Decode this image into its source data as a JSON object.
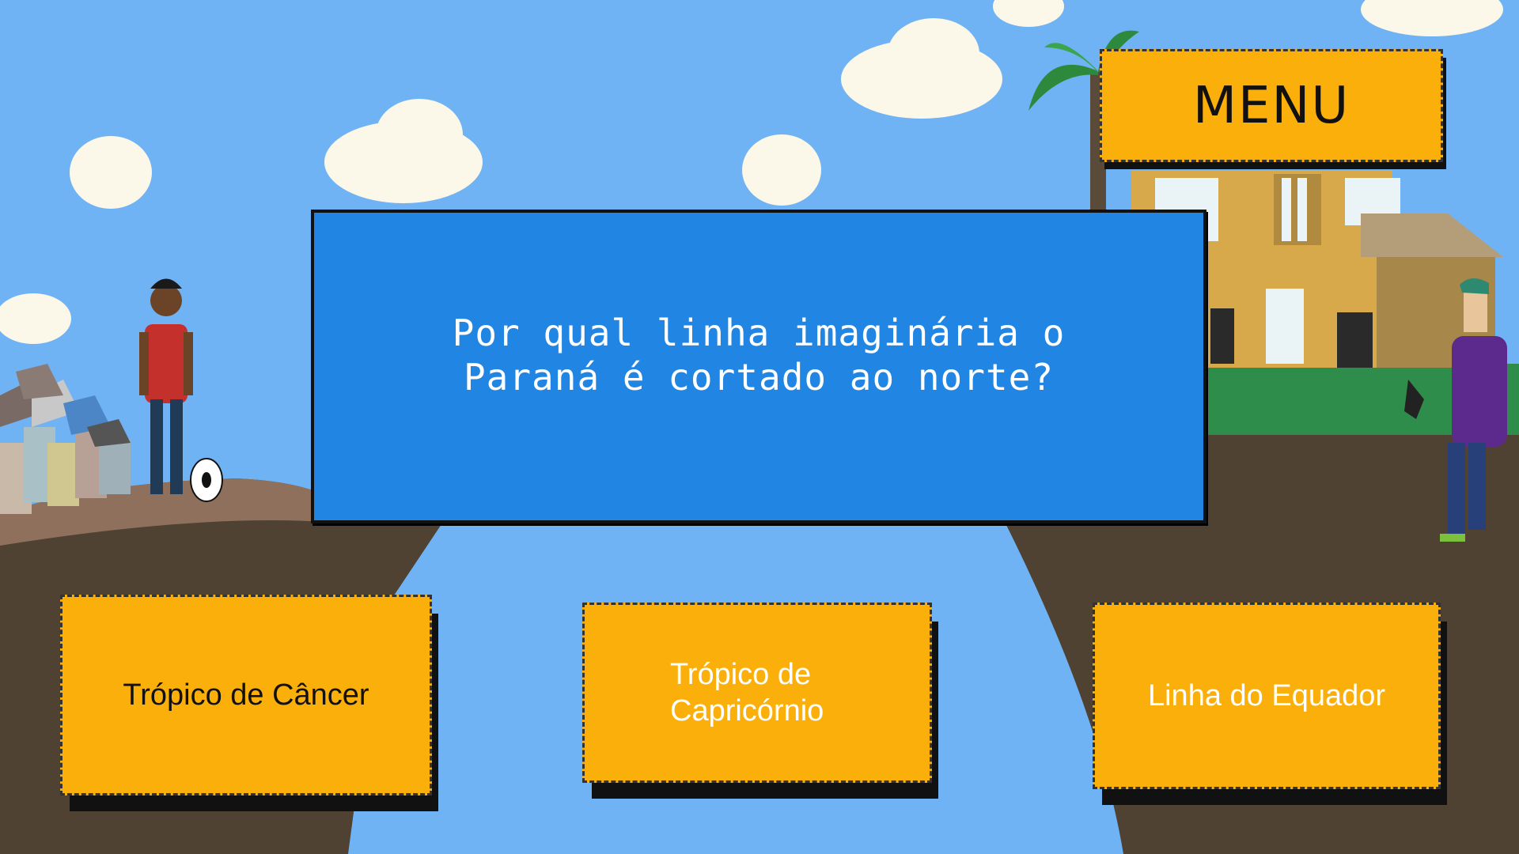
{
  "menu": {
    "label": "MENU"
  },
  "question": {
    "text": "Por qual linha imaginária o Paraná é cortado ao norte?"
  },
  "options": [
    {
      "label": "Trópico de Câncer",
      "color": "#111111"
    },
    {
      "label": "Trópico de Capricórnio",
      "color": "#ffffff"
    },
    {
      "label": "Linha do Equador",
      "color": "#ffffff"
    }
  ],
  "colors": {
    "sky": "#70b3f4",
    "panel": "#2185e4",
    "button": "#fbaf0a"
  }
}
